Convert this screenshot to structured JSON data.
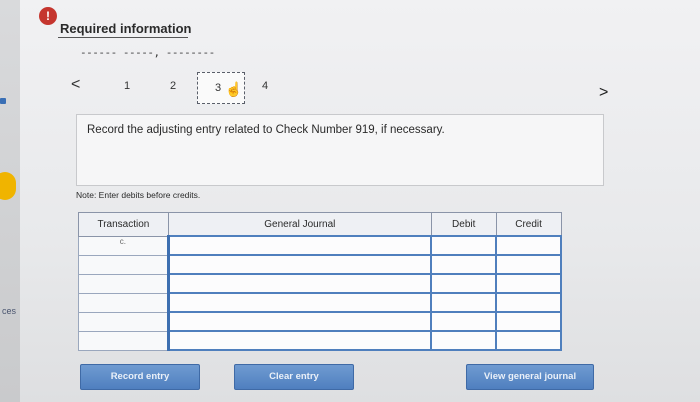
{
  "header": {
    "alert_glyph": "!",
    "title": "Required information",
    "dashes": "------ -----, --------"
  },
  "pager": {
    "prev": "<",
    "next": ">",
    "pages": [
      "1",
      "2",
      "3",
      "4"
    ],
    "current": "3"
  },
  "question": {
    "text": "Record the adjusting entry related to Check Number 919, if necessary."
  },
  "note": "Note: Enter debits before credits.",
  "journal": {
    "columns": [
      "Transaction",
      "General Journal",
      "Debit",
      "Credit"
    ],
    "rows": [
      {
        "transaction": "c.",
        "account": "",
        "debit": "",
        "credit": ""
      },
      {
        "transaction": "",
        "account": "",
        "debit": "",
        "credit": ""
      },
      {
        "transaction": "",
        "account": "",
        "debit": "",
        "credit": ""
      },
      {
        "transaction": "",
        "account": "",
        "debit": "",
        "credit": ""
      },
      {
        "transaction": "",
        "account": "",
        "debit": "",
        "credit": ""
      },
      {
        "transaction": "",
        "account": "",
        "debit": "",
        "credit": ""
      }
    ]
  },
  "buttons": {
    "record": "Record entry",
    "clear": "Clear entry",
    "view": "View general journal"
  },
  "sidebar": {
    "partial_text": "ces"
  },
  "colors": {
    "button": "#5a89c6",
    "alert": "#c5352e",
    "accent_yellow": "#f0b400"
  }
}
